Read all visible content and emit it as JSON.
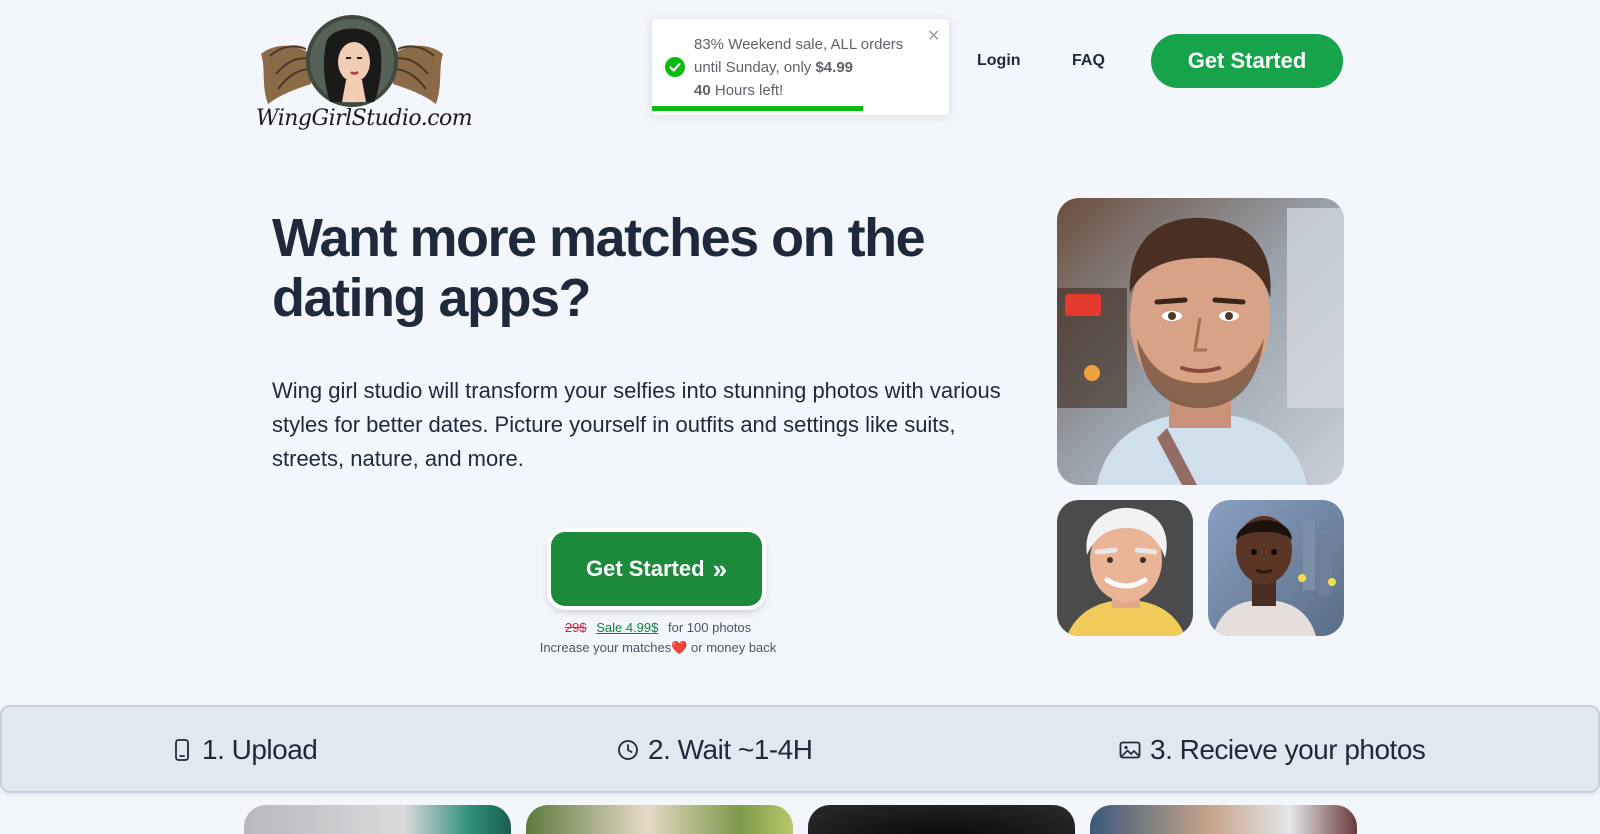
{
  "brand": {
    "logo_text": "WingGirlStudio.com"
  },
  "toast": {
    "line1": "83% Weekend sale, ALL orders",
    "line2_prefix": "until Sunday, only ",
    "line2_price": "$4.99",
    "line3_hours": "40",
    "line3_suffix": " Hours left!",
    "close_glyph": "✕",
    "progress": 0.71
  },
  "nav": {
    "login": "Login",
    "faq": "FAQ",
    "get_started": "Get Started"
  },
  "hero": {
    "title": "Want more matches on the dating apps?",
    "description": "Wing girl studio will transform your selfies into stunning photos with various styles for better dates. Picture yourself in outfits and settings like suits, streets, nature, and more.",
    "cta_label": "Get Started",
    "cta_icon": "»",
    "price_old": "29$",
    "price_sale": "Sale 4.99$",
    "price_suffix": "for 100 photos",
    "guarantee_prefix": "Increase your matches",
    "guarantee_heart": "❤️",
    "guarantee_suffix": " or money back"
  },
  "steps": [
    {
      "label": "1. Upload",
      "icon": "phone-icon"
    },
    {
      "label": "2. Wait ~1-4H",
      "icon": "clock-icon"
    },
    {
      "label": "3. Recieve your photos",
      "icon": "image-icon"
    }
  ],
  "colors": {
    "brand_green": "#16a34a",
    "cta_green": "#1b8a3b",
    "text_dark": "#1e293b",
    "background": "#f3f7fb",
    "toast_progress": "#07bc0c",
    "sale_old_red": "#e11d48"
  }
}
